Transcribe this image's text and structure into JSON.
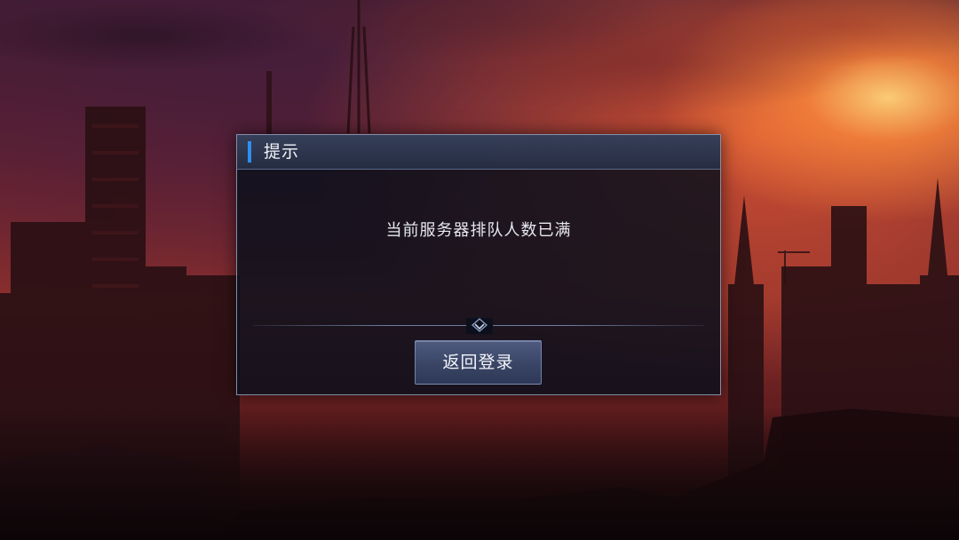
{
  "dialog": {
    "title": "提示",
    "message": "当前服务器排队人数已满",
    "button_label": "返回登录"
  },
  "colors": {
    "accent": "#2f8ff0",
    "button_bg": "#3a4565",
    "dialog_bg": "#0c101c"
  },
  "icons": {
    "divider_ornament": "chevron-diamond-icon"
  }
}
